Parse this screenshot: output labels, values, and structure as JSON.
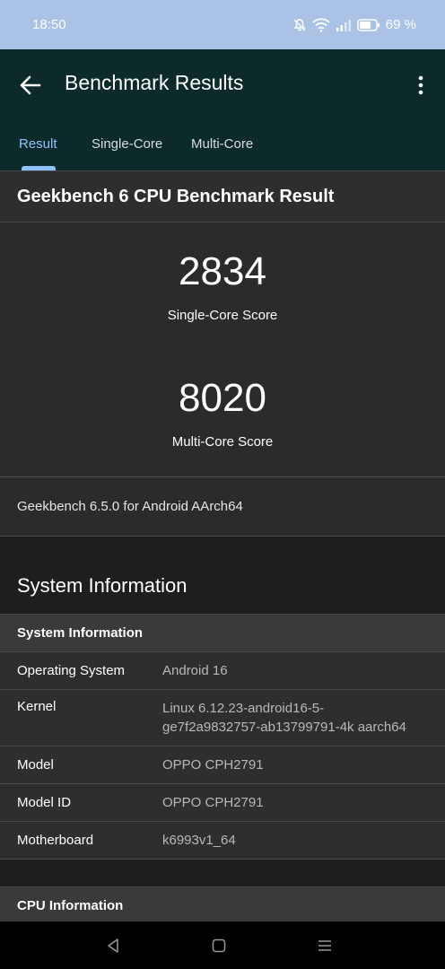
{
  "status_bar": {
    "time": "18:50",
    "battery_percent": "69 %"
  },
  "app_bar": {
    "title": "Benchmark Results",
    "tabs": [
      {
        "label": "Result",
        "active": true
      },
      {
        "label": "Single-Core",
        "active": false
      },
      {
        "label": "Multi-Core",
        "active": false
      }
    ]
  },
  "result": {
    "header": "Geekbench 6 CPU Benchmark Result",
    "single_core": {
      "score": "2834",
      "label": "Single-Core Score"
    },
    "multi_core": {
      "score": "8020",
      "label": "Multi-Core Score"
    },
    "version": "Geekbench 6.5.0 for Android AArch64"
  },
  "system_information": {
    "section_title": "System Information",
    "table_header": "System Information",
    "rows": [
      {
        "key": "Operating System",
        "value": "Android 16"
      },
      {
        "key": "Kernel",
        "value_line1": "Linux 6.12.23-android16-5-",
        "value_line2": "ge7f2a9832757-ab13799791-4k aarch64"
      },
      {
        "key": "Model",
        "value": "OPPO CPH2791"
      },
      {
        "key": "Model ID",
        "value": "OPPO CPH2791"
      },
      {
        "key": "Motherboard",
        "value": "k6993v1_64"
      }
    ]
  },
  "cpu_information": {
    "table_header": "CPU Information"
  },
  "icons": {
    "back": "arrow-left-icon",
    "more": "more-vert-icon",
    "nav": [
      "nav-back-icon",
      "nav-home-icon",
      "nav-recents-icon"
    ]
  },
  "colors": {
    "status_bar": "#a9c2e6",
    "app_bar": "#0d2a2a",
    "active_tab": "#8ec2ff",
    "background": "#2b2b2b"
  }
}
